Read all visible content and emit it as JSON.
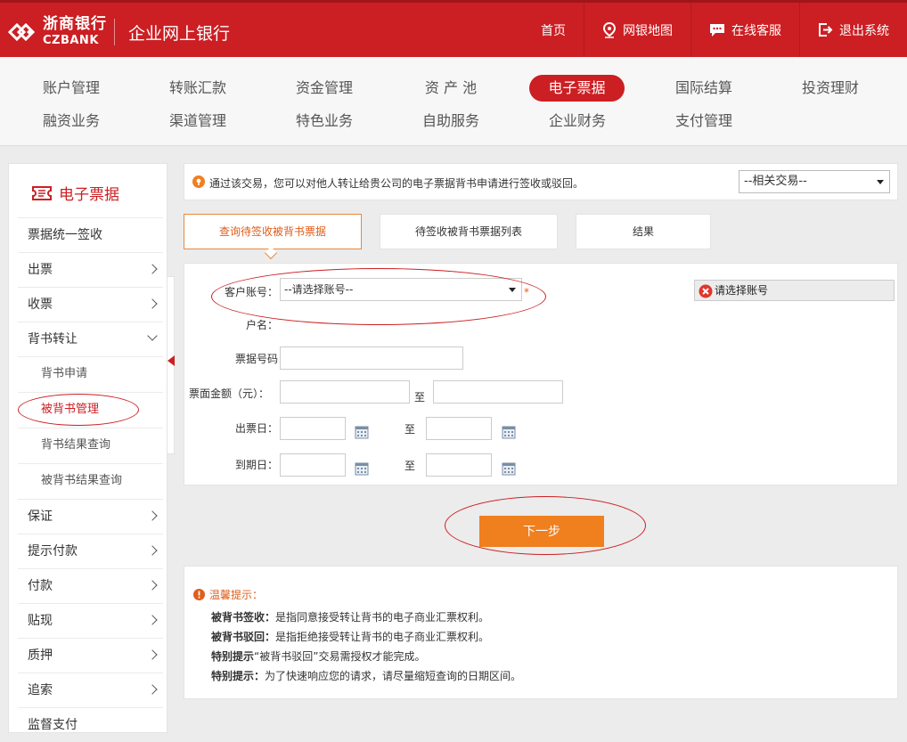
{
  "header": {
    "logo_cn": "浙商银行",
    "logo_en": "CZBANK",
    "portal_title": "企业网上银行",
    "nav": [
      {
        "label": "首页",
        "icon": ""
      },
      {
        "label": "网银地图",
        "icon": "map-pin-icon"
      },
      {
        "label": "在线客服",
        "icon": "chat-icon"
      },
      {
        "label": "退出系统",
        "icon": "logout-icon"
      }
    ]
  },
  "menu": {
    "row1": [
      "账户管理",
      "转账汇款",
      "资金管理",
      "资 产 池",
      "电子票据",
      "国际结算",
      "投资理财"
    ],
    "row2": [
      "融资业务",
      "渠道管理",
      "特色业务",
      "自助服务",
      "企业财务",
      "支付管理"
    ],
    "active": "电子票据"
  },
  "sidebar": {
    "title": "电子票据",
    "items": [
      {
        "label": "票据统一签收"
      },
      {
        "label": "出票"
      },
      {
        "label": "收票"
      },
      {
        "label": "背书转让"
      },
      {
        "label": "背书申请"
      },
      {
        "label": "被背书管理"
      },
      {
        "label": "背书结果查询"
      },
      {
        "label": "被背书结果查询"
      },
      {
        "label": "保证"
      },
      {
        "label": "提示付款"
      },
      {
        "label": "付款"
      },
      {
        "label": "贴现"
      },
      {
        "label": "质押"
      },
      {
        "label": "追索"
      },
      {
        "label": "监督支付"
      }
    ]
  },
  "info": {
    "text": "通过该交易，您可以对他人转让给贵公司的电子票据背书申请进行签收或驳回。",
    "related_select": "--相关交易--"
  },
  "steps": [
    "查询待签收被背书票据",
    "待签收被背书票据列表",
    "结果"
  ],
  "form": {
    "account_label": "客户账号：",
    "account_value": "--请选择账号--",
    "required_mark": "*",
    "error_text": "请选择账号",
    "name_label": "户名：",
    "bill_no_label": "票据号码",
    "amount_label": "票面金额（元）：",
    "to": "至",
    "issue_date_label": "出票日：",
    "due_date_label": "到期日："
  },
  "next_button": "下一步",
  "tips": {
    "title": "温馨提示：",
    "lines": [
      {
        "bold": "被背书签收：",
        "text": "是指同意接受转让背书的电子商业汇票权利。"
      },
      {
        "bold": "被背书驳回：",
        "text": "是指拒绝接受转让背书的电子商业汇票权利。"
      },
      {
        "bold": "特别提示",
        "text": "“被背书驳回”交易需授权才能完成。"
      },
      {
        "bold": "特别提示：",
        "text": "为了快速响应您的请求，请尽量缩短查询的日期区间。"
      }
    ]
  },
  "colors": {
    "brand": "#cc1f23",
    "accent": "#f07f1e"
  }
}
